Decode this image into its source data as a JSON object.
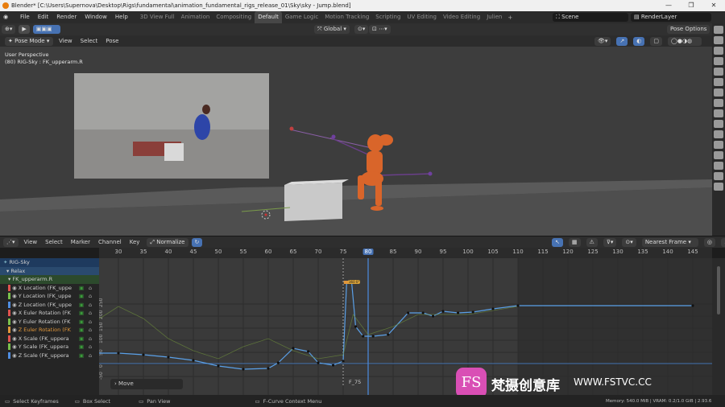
{
  "window": {
    "title": "Blender* [C:\\Users\\Supernova\\Desktop\\Rigs\\fundamental\\animation_fundamental_rigs_release_01\\Sky\\sky - Jump.blend]"
  },
  "menu": [
    "File",
    "Edit",
    "Render",
    "Window",
    "Help"
  ],
  "workspaces": [
    "3D View Full",
    "Animation",
    "Compositing",
    "Default",
    "Game Logic",
    "Motion Tracking",
    "Scripting",
    "UV Editing",
    "Video Editing",
    "Julien"
  ],
  "active_workspace": "Default",
  "scene": {
    "name": "Scene",
    "render_layer": "RenderLayer"
  },
  "viewport_header": {
    "orientation": "Global",
    "pose_options": "Pose Options"
  },
  "viewport_header2": {
    "mode": "Pose Mode",
    "items": [
      "View",
      "Select",
      "Pose"
    ]
  },
  "viewport_overlay": {
    "line1": "User Perspective",
    "line2": "(80) RIG-Sky : FK_upperarm.R"
  },
  "graph_header": {
    "items": [
      "View",
      "Select",
      "Marker",
      "Channel",
      "Key"
    ],
    "normalize": "Normalize",
    "pivot": "Nearest Frame"
  },
  "ruler": {
    "frames": [
      30,
      35,
      40,
      45,
      50,
      55,
      60,
      65,
      70,
      75,
      80,
      85,
      90,
      95,
      100,
      105,
      110,
      115,
      120,
      125,
      130,
      135,
      140,
      145
    ],
    "current": 80,
    "range_end": 110
  },
  "y_axis": {
    "labels": [
      "250",
      "200",
      "150",
      "100",
      "50",
      "0",
      "-50"
    ]
  },
  "channels": {
    "rig": "RIG-Sky",
    "action": "Relax",
    "group": "FK_upperarm.R",
    "items": [
      {
        "label": "X Location (FK_uppe",
        "color": "#e0534f"
      },
      {
        "label": "Y Location (FK_uppe",
        "color": "#7ac04b"
      },
      {
        "label": "Z Location (FK_uppe",
        "color": "#4f8de0"
      },
      {
        "label": "X Euler Rotation (FK",
        "color": "#e0534f"
      },
      {
        "label": "Y Euler Rotation (FK",
        "color": "#7ac04b"
      },
      {
        "label": "Z Euler Rotation (FK",
        "color": "#e0963a"
      },
      {
        "label": "X Scale (FK_uppera",
        "color": "#e0534f"
      },
      {
        "label": "Y Scale (FK_uppera",
        "color": "#7ac04b"
      },
      {
        "label": "Z Scale (FK_uppera",
        "color": "#4f8de0"
      }
    ]
  },
  "graph": {
    "move_label": "Move",
    "marker": "F_75",
    "key_label": "360 0°"
  },
  "status": {
    "select": "Select Keyframes",
    "box": "Box Select",
    "pan": "Pan View",
    "context": "F-Curve Context Menu",
    "memory": "Memory: 540.0 MiB | VRAM: 0.2/1.0 GiB | 2.93.6"
  },
  "watermark": {
    "logo": "FS",
    "text": "梵摄创意库",
    "url": "WWW.FSTVC.CC"
  }
}
